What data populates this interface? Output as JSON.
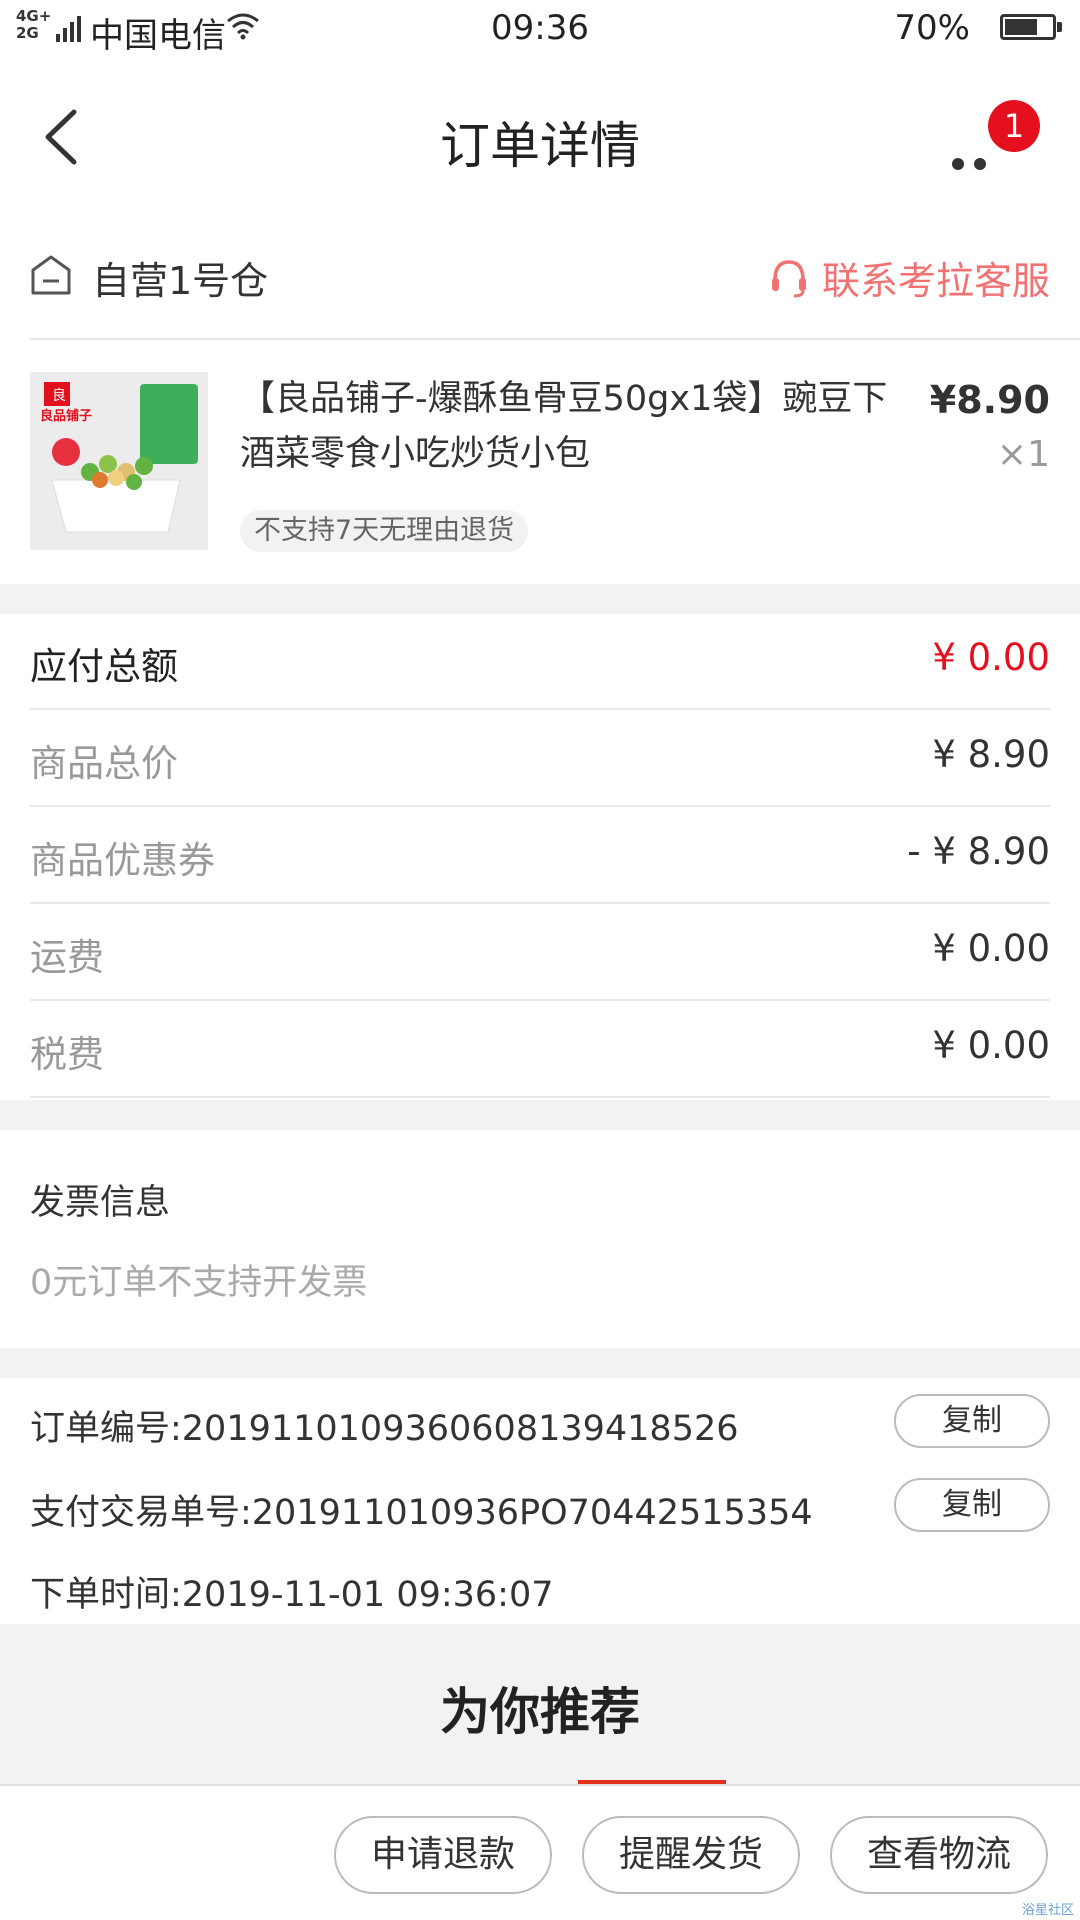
{
  "status_bar": {
    "network": "4G+\n2G",
    "carrier": "中国电信",
    "time": "09:36",
    "battery": "70%",
    "battery_level": 0.7
  },
  "nav": {
    "title": "订单详情",
    "badge": "1",
    "back_icon": "chevron-left-icon",
    "more_icon": "more-dots-icon"
  },
  "store": {
    "name": "自营1号仓",
    "service_label": "联系考拉客服",
    "service_color": "#f07272"
  },
  "product": {
    "title": "【良品铺子-爆酥鱼骨豆50gx1袋】豌豆下酒菜零食小吃炒货小包",
    "price": "¥8.90",
    "quantity": "×1",
    "tag": "不支持7天无理由退货",
    "image_brand": "良品铺子"
  },
  "fees": [
    {
      "label": "应付总额",
      "value": "¥ 0.00",
      "emphasis": true
    },
    {
      "label": "商品总价",
      "value": "¥ 8.90"
    },
    {
      "label": "商品优惠券",
      "value": "- ¥ 8.90"
    },
    {
      "label": "运费",
      "value": "¥ 0.00"
    },
    {
      "label": "税费",
      "value": "¥ 0.00"
    }
  ],
  "invoice": {
    "title": "发票信息",
    "note": "0元订单不支持开发票"
  },
  "order_info": {
    "order_no": "订单编号:2019110109360608139418526",
    "pay_no": "支付交易单号:201911010936PO70442515354",
    "order_time": "下单时间:2019-11-01 09:36:07",
    "copy_label": "复制"
  },
  "recommend": {
    "title": "为你推荐"
  },
  "actions": {
    "refund": "申请退款",
    "remind": "提醒发货",
    "logistics": "查看物流"
  },
  "watermark": "浴星社区",
  "colors": {
    "accent_red": "#e4101e",
    "gray_bg": "#f2f2f2"
  }
}
